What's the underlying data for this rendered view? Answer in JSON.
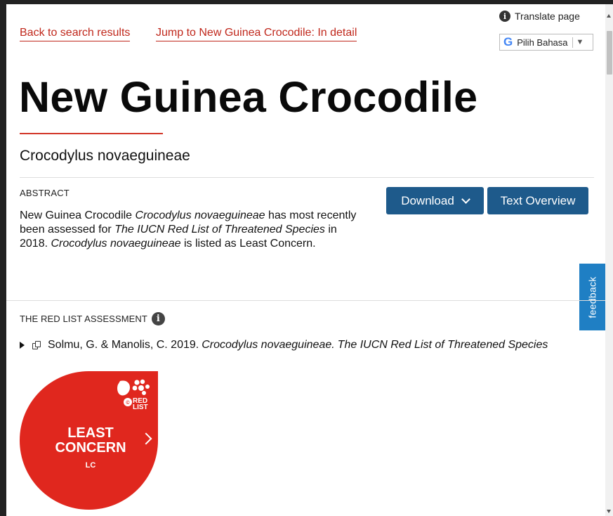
{
  "nav": {
    "back_link": "Back to search results",
    "jump_link": "Jump to New Guinea Crocodile: In detail"
  },
  "translate": {
    "label": "Translate page",
    "google_mark": "G",
    "select_value": "Pilih Bahasa",
    "select_arrow": "▼"
  },
  "species": {
    "title": "New Guinea Crocodile",
    "scientific_name": "Crocodylus novaeguineae"
  },
  "abstract": {
    "label": "ABSTRACT",
    "t1": "New Guinea Crocodile ",
    "t2": "Crocodylus novaeguineae",
    "t3": " has most recently been assessed for ",
    "t4": "The IUCN Red List of Threatened Species",
    "t5": " in 2018. ",
    "t6": "Crocodylus novaeguineae",
    "t7": " is listed as Least Concern."
  },
  "buttons": {
    "download": "Download",
    "text_overview": "Text Overview"
  },
  "feedback": "feedback",
  "assessment": {
    "label": "THE RED LIST ASSESSMENT",
    "info": "i",
    "citation_plain": "Solmu, G. & Manolis, C. 2019.",
    "citation_species": "Crocodylus novaeguineae.",
    "citation_italic": "The IUCN Red List of Threatened Species"
  },
  "badge": {
    "category": "LEAST CONCERN",
    "code": "LC",
    "logo_text_1": "RED",
    "logo_text_2": "LIST"
  },
  "colors": {
    "accent_red": "#d2382a",
    "link_red": "#c0281c",
    "button_blue": "#1e5a8b",
    "feedback_blue": "#1f7fc4",
    "badge_red": "#e0271e"
  },
  "icons": [
    "info-icon",
    "google-icon",
    "chevron-down-icon",
    "expand-triangle-icon",
    "copy-icon",
    "chevron-right-icon",
    "red-list-logo"
  ]
}
